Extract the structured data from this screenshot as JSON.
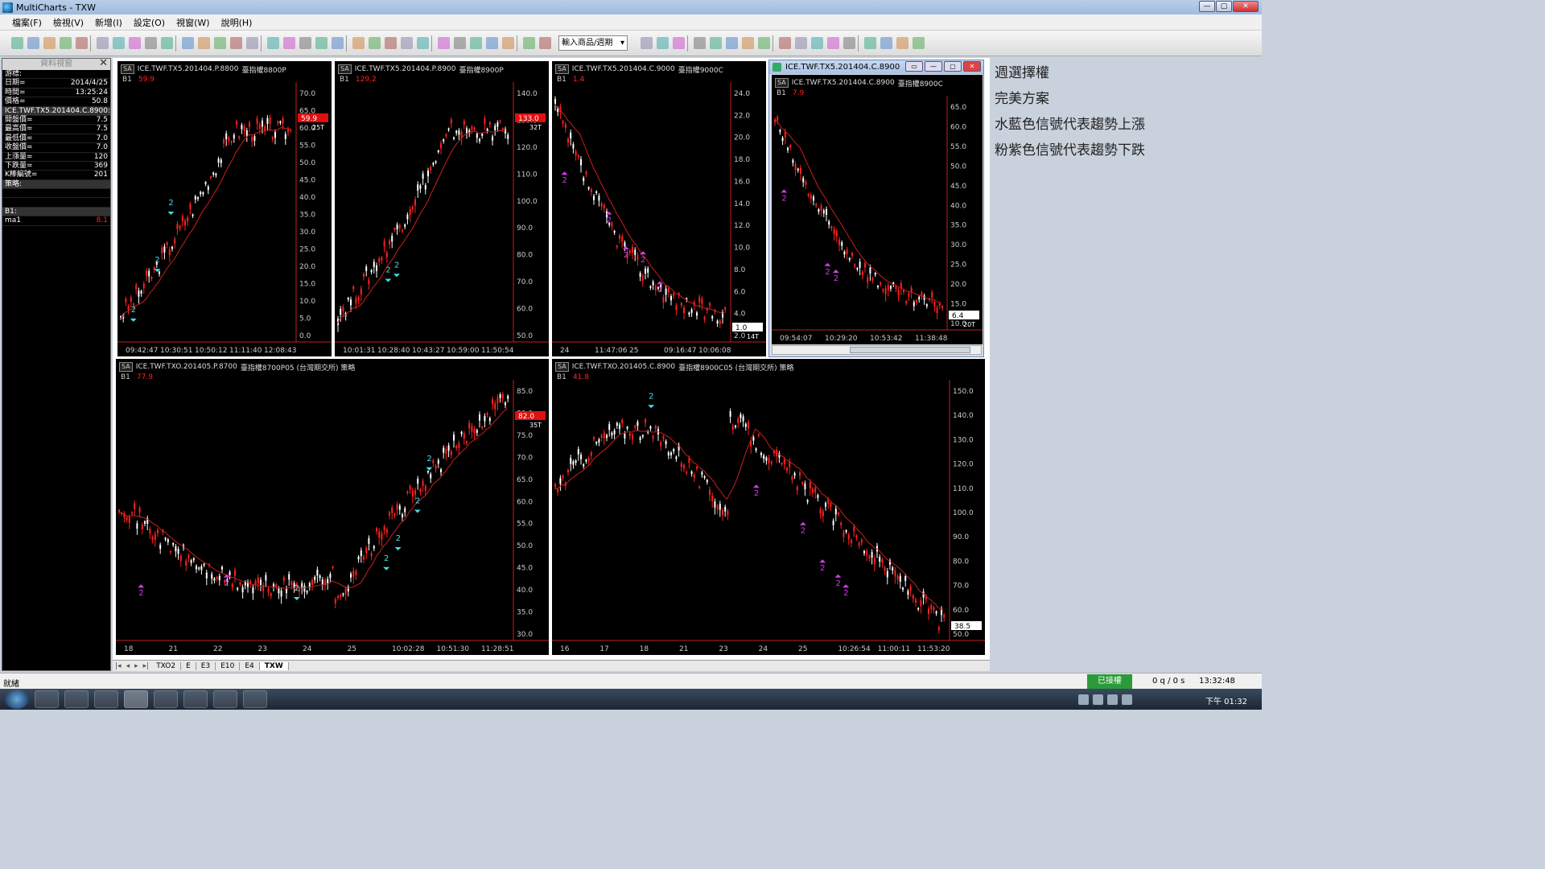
{
  "window": {
    "title": "MultiCharts - TXW",
    "min": "—",
    "max": "▢",
    "close": "✕"
  },
  "menu": [
    "檔案(F)",
    "檢視(V)",
    "新增(I)",
    "設定(O)",
    "視窗(W)",
    "說明(H)"
  ],
  "toolbar": {
    "symbol_placeholder": "輸入商品/週期"
  },
  "data_window": {
    "title": "資料視窗",
    "close": "✕",
    "rows": [
      {
        "label": "游標:",
        "value": ""
      },
      {
        "label": "日期=",
        "value": "2014/4/25"
      },
      {
        "label": "時間=",
        "value": "13:25:24"
      },
      {
        "label": "價格=",
        "value": "50.8"
      },
      {
        "label": "ICE.TWF.TX5.201404.C.8900:",
        "value": ""
      },
      {
        "label": "開盤價=",
        "value": "7.5"
      },
      {
        "label": "最高價=",
        "value": "7.5"
      },
      {
        "label": "最低價=",
        "value": "7.0"
      },
      {
        "label": "收盤價=",
        "value": "7.0"
      },
      {
        "label": "上漲量=",
        "value": "120"
      },
      {
        "label": "下跌量=",
        "value": "369"
      },
      {
        "label": "K棒編號=",
        "value": "201"
      },
      {
        "label": "策略:",
        "value": ""
      },
      {
        "label": "",
        "value": ""
      },
      {
        "label": "",
        "value": ""
      },
      {
        "label": "B1:",
        "value": ""
      },
      {
        "label": "ma1",
        "value": "8.1"
      }
    ]
  },
  "charts": [
    {
      "id": "c1",
      "symbol": "ICE.TWF.TX5.201404.P.8800",
      "desc": "臺指權8800P",
      "b1": "59.9",
      "sa": "SA",
      "yticks": [
        "70.0",
        "65.0",
        "60.0",
        "55.0",
        "50.0",
        "45.0",
        "40.0",
        "35.0",
        "30.0",
        "25.0",
        "20.0",
        "15.0",
        "10.0",
        "5.0",
        "0.0"
      ],
      "xticks": [
        "09:42:47",
        "10:30:51",
        "10:50:12",
        "11:11:40",
        "12:08:43"
      ],
      "price_tag": "59.9",
      "bars_tag": "25T",
      "trend": "up",
      "buy": [
        [
          0.06,
          0.88
        ],
        [
          0.2,
          0.68
        ],
        [
          0.28,
          0.45
        ]
      ],
      "sell": []
    },
    {
      "id": "c2",
      "symbol": "ICE.TWF.TX5.201404.P.8900",
      "desc": "臺指權8900P",
      "b1": "129.2",
      "sa": "SA",
      "yticks": [
        "140.0",
        "130.0",
        "120.0",
        "110.0",
        "100.0",
        "90.0",
        "80.0",
        "70.0",
        "60.0",
        "50.0"
      ],
      "xticks": [
        "10:01:31",
        "10:28:40",
        "10:43:27",
        "10:59:00",
        "11:50:54"
      ],
      "price_tag": "133.0",
      "bars_tag": "32T",
      "trend": "up",
      "buy": [
        [
          0.28,
          0.72
        ],
        [
          0.33,
          0.7
        ]
      ],
      "sell": []
    },
    {
      "id": "c3",
      "symbol": "ICE.TWF.TX5.201404.C.9000",
      "desc": "臺指權9000C",
      "b1": "1.4",
      "sa": "SA",
      "yticks": [
        "24.0",
        "22.0",
        "20.0",
        "18.0",
        "16.0",
        "14.0",
        "12.0",
        "10.0",
        "8.0",
        "6.0",
        "4.0",
        "2.0"
      ],
      "xticks": [
        "24",
        "11:47:06",
        "25",
        "09:16:47",
        "10:06:08"
      ],
      "price_tag": "1.0",
      "bars_tag": "14T",
      "trend": "down",
      "buy": [],
      "sell": [
        [
          0.04,
          0.36
        ],
        [
          0.3,
          0.52
        ],
        [
          0.4,
          0.66
        ],
        [
          0.5,
          0.68
        ],
        [
          0.6,
          0.8
        ]
      ]
    },
    {
      "id": "c4",
      "symbol": "ICE.TWF.TX5.201404.C.8900",
      "desc": "臺指權8900C",
      "b1": "7.9",
      "sa": "SA",
      "yticks": [
        "65.0",
        "60.0",
        "55.0",
        "50.0",
        "45.0",
        "40.0",
        "35.0",
        "30.0",
        "25.0",
        "20.0",
        "15.0",
        "10.0"
      ],
      "xticks": [
        "09:54:07",
        "10:29:20",
        "10:53:42",
        "11:38:48"
      ],
      "price_tag": "6.4",
      "bars_tag": "20T",
      "trend": "down",
      "buy": [],
      "sell": [
        [
          0.04,
          0.42
        ],
        [
          0.3,
          0.75
        ],
        [
          0.35,
          0.78
        ]
      ]
    },
    {
      "id": "c5",
      "symbol": "ICE.TWF.TXO.201405.P.8700",
      "desc": "臺指權8700P05 (台灣期交所) 策略",
      "b1": "77.9",
      "sa": "SA",
      "yticks": [
        "85.0",
        "80.0",
        "75.0",
        "70.0",
        "65.0",
        "60.0",
        "55.0",
        "50.0",
        "45.0",
        "40.0",
        "35.0",
        "30.0"
      ],
      "xticks": [
        "18",
        "21",
        "22",
        "23",
        "24",
        "25",
        "10:02:28",
        "10:51:30",
        "11:28:51"
      ],
      "price_tag": "82.0",
      "bars_tag": "35T",
      "trend": "wave_up",
      "buy": [
        [
          0.45,
          0.8
        ],
        [
          0.68,
          0.68
        ],
        [
          0.71,
          0.6
        ],
        [
          0.76,
          0.45
        ],
        [
          0.79,
          0.28
        ]
      ],
      "sell": [
        [
          0.05,
          0.82
        ],
        [
          0.27,
          0.78
        ]
      ]
    },
    {
      "id": "c6",
      "symbol": "ICE.TWF.TXO.201405.C.8900",
      "desc": "臺指權8900C05 (台灣期交所) 策略",
      "b1": "41.8",
      "sa": "SA",
      "yticks": [
        "150.0",
        "140.0",
        "130.0",
        "120.0",
        "110.0",
        "100.0",
        "90.0",
        "80.0",
        "70.0",
        "60.0",
        "50.0"
      ],
      "xticks": [
        "16",
        "17",
        "18",
        "21",
        "23",
        "24",
        "25",
        "10:26:54",
        "11:00:11",
        "11:53:20"
      ],
      "price_tag": "38.5",
      "bars_tag": "",
      "trend": "wave_down",
      "buy": [
        [
          0.24,
          0.03
        ]
      ],
      "sell": [
        [
          0.51,
          0.42
        ],
        [
          0.63,
          0.57
        ],
        [
          0.68,
          0.72
        ],
        [
          0.72,
          0.78
        ],
        [
          0.74,
          0.82
        ]
      ]
    }
  ],
  "notes": [
    "週選擇權",
    "完美方案",
    "水藍色信號代表趨勢上漲",
    "粉紫色信號代表趨勢下跌"
  ],
  "sheet_tabs": [
    "TXO2",
    "E",
    "E3",
    "E10",
    "E4",
    "TXW"
  ],
  "sheet_active": "TXW",
  "status": {
    "text": "就緒",
    "connection": "已接權",
    "rate": "0 q / 0 s",
    "clock": "13:32:48"
  },
  "taskbar": {
    "time": "下午 01:32"
  },
  "colors": {
    "up_signal": "#3fe0e6",
    "down_signal": "#d23ce6",
    "candle_up": "#ff2020",
    "candle_down": "#ffffff",
    "ma": "#c8201c"
  }
}
